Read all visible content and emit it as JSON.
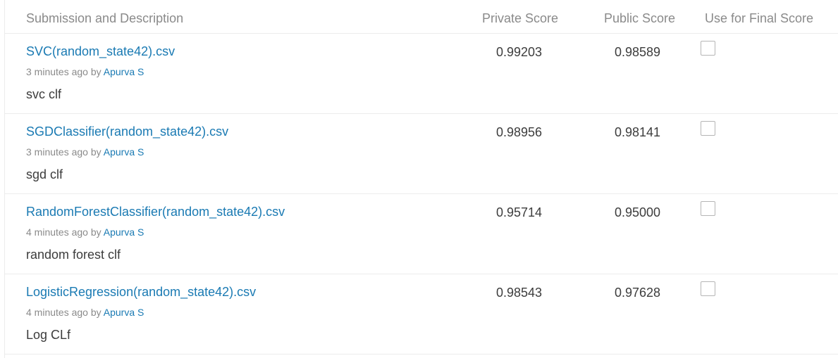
{
  "header": {
    "description": "Submission and Description",
    "private_score": "Private Score",
    "public_score": "Public Score",
    "final_score": "Use for Final Score"
  },
  "submissions": [
    {
      "file": "SVC(random_state42).csv",
      "time": "3 minutes ago",
      "by": "by",
      "author": "Apurva S",
      "description": "svc clf",
      "private_score": "0.99203",
      "public_score": "0.98589",
      "use_for_final": false
    },
    {
      "file": "SGDClassifier(random_state42).csv",
      "time": "3 minutes ago",
      "by": "by",
      "author": "Apurva S",
      "description": "sgd clf",
      "private_score": "0.98956",
      "public_score": "0.98141",
      "use_for_final": false
    },
    {
      "file": "RandomForestClassifier(random_state42).csv",
      "time": "4 minutes ago",
      "by": "by",
      "author": "Apurva S",
      "description": "random forest clf",
      "private_score": "0.95714",
      "public_score": "0.95000",
      "use_for_final": false
    },
    {
      "file": "LogisticRegression(random_state42).csv",
      "time": "4 minutes ago",
      "by": "by",
      "author": "Apurva S",
      "description": "Log CLf",
      "private_score": "0.98543",
      "public_score": "0.97628",
      "use_for_final": false
    }
  ],
  "colors": {
    "link": "#1a7ab3",
    "muted": "#8a8a8a",
    "text": "#3c3c3c",
    "divider": "#ececec"
  }
}
